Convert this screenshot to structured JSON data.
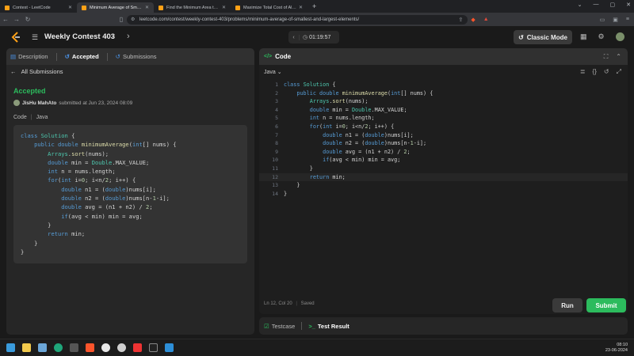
{
  "browser": {
    "tabs": [
      {
        "title": "Contest - LeetCode",
        "active": false,
        "color": "#ffa116"
      },
      {
        "title": "Minimum Average of Smallest and Largest Elements",
        "active": true,
        "color": "#ffa116"
      },
      {
        "title": "Find the Minimum Area to Cover All Ones I",
        "active": false,
        "color": "#ffa116"
      },
      {
        "title": "Maximize Total Cost of Alternating Subarrays",
        "active": false,
        "color": "#ffa116"
      }
    ],
    "url": "leetcode.com/contest/weekly-contest-403/problems/minimum-average-of-smallest-and-largest-elements/"
  },
  "header": {
    "contest_title": "Weekly Contest 403",
    "timer": "01:19:57",
    "mode_label": "Classic Mode"
  },
  "left": {
    "tabs": [
      {
        "label": "Description",
        "active": false
      },
      {
        "label": "Accepted",
        "active": true
      },
      {
        "label": "Submissions",
        "active": false
      }
    ],
    "back_label": "All Submissions",
    "status": "Accepted",
    "author": "JisHu MahAto",
    "submitted_text": "submitted at Jun 23, 2024 08:09",
    "code_label": "Code",
    "lang_label": "Java"
  },
  "editor": {
    "title": "Code",
    "language": "Java",
    "status_text": "Ln 12, Col 20",
    "saved_text": "Saved",
    "run_label": "Run",
    "submit_label": "Submit",
    "line_numbers": [
      "1",
      "2",
      "3",
      "4",
      "5",
      "6",
      "7",
      "8",
      "9",
      "10",
      "11",
      "12",
      "13",
      "14"
    ]
  },
  "bottom": {
    "testcase_label": "Testcase",
    "result_label": "Test Result"
  },
  "taskbar": {
    "time": "08:10",
    "date": "23-06-2024"
  },
  "colors": {
    "accent_green": "#2cbb5d",
    "brand_orange": "#ffa116"
  }
}
